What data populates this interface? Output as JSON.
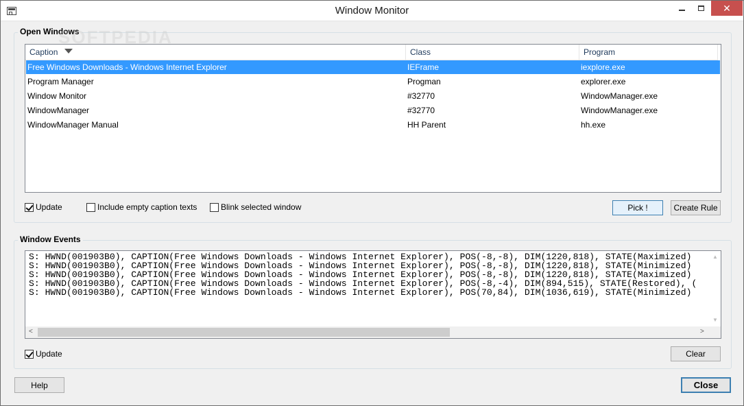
{
  "window": {
    "title": "Window Monitor",
    "minimize_icon": "minimize-icon",
    "maximize_icon": "maximize-icon",
    "close_icon": "close-icon",
    "close_glyph": "✕"
  },
  "watermark": "SOFTPEDIA",
  "open_windows": {
    "label": "Open Windows",
    "columns": [
      "Caption",
      "Class",
      "Program"
    ],
    "rows": [
      {
        "caption": "Free Windows Downloads - Windows Internet Explorer",
        "class": "IEFrame",
        "program": "iexplore.exe",
        "selected": true
      },
      {
        "caption": "Program Manager",
        "class": "Progman",
        "program": "explorer.exe",
        "selected": false
      },
      {
        "caption": "Window Monitor",
        "class": "#32770",
        "program": "WindowManager.exe",
        "selected": false
      },
      {
        "caption": "WindowManager",
        "class": "#32770",
        "program": "WindowManager.exe",
        "selected": false
      },
      {
        "caption": "WindowManager Manual",
        "class": "HH Parent",
        "program": "hh.exe",
        "selected": false
      }
    ],
    "update_label": "Update",
    "update_checked": true,
    "include_empty_label": "Include empty caption texts",
    "include_empty_checked": false,
    "blink_label": "Blink selected window",
    "blink_checked": false,
    "pick_label": "Pick !",
    "create_rule_label": "Create Rule"
  },
  "window_events": {
    "label": "Window Events",
    "lines": [
      "S: HWND(001903B0), CAPTION(Free Windows Downloads - Windows Internet Explorer), POS(-8,-8), DIM(1220,818), STATE(Maximized)",
      "S: HWND(001903B0), CAPTION(Free Windows Downloads - Windows Internet Explorer), POS(-8,-8), DIM(1220,818), STATE(Minimized)",
      "S: HWND(001903B0), CAPTION(Free Windows Downloads - Windows Internet Explorer), POS(-8,-8), DIM(1220,818), STATE(Maximized)",
      "S: HWND(001903B0), CAPTION(Free Windows Downloads - Windows Internet Explorer), POS(-8,-4), DIM(894,515), STATE(Restored), (",
      "S: HWND(001903B0), CAPTION(Free Windows Downloads - Windows Internet Explorer), POS(70,84), DIM(1036,619), STATE(Minimized)"
    ],
    "update_label": "Update",
    "update_checked": true,
    "clear_label": "Clear"
  },
  "footer": {
    "help_label": "Help",
    "close_label": "Close"
  },
  "colors": {
    "selection": "#3399ff",
    "title_close": "#c7504e",
    "focus_border": "#3c7fb1"
  }
}
